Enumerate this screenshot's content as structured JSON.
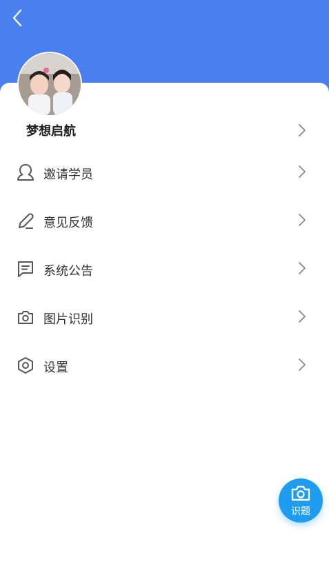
{
  "header": {
    "back_icon": "chevron-left-icon",
    "background": "#4a7ff0"
  },
  "profile": {
    "username": "梦想启航",
    "avatar": "avatar-photo"
  },
  "menu": [
    {
      "label": "邀请学员",
      "icon": "user-icon"
    },
    {
      "label": "意见反馈",
      "icon": "pencil-icon"
    },
    {
      "label": "系统公告",
      "icon": "message-icon"
    },
    {
      "label": "图片识别",
      "icon": "camera-icon"
    },
    {
      "label": "设置",
      "icon": "settings-icon"
    }
  ],
  "fab": {
    "label": "识题",
    "icon": "camera-icon",
    "color": "#1e9cf0"
  }
}
